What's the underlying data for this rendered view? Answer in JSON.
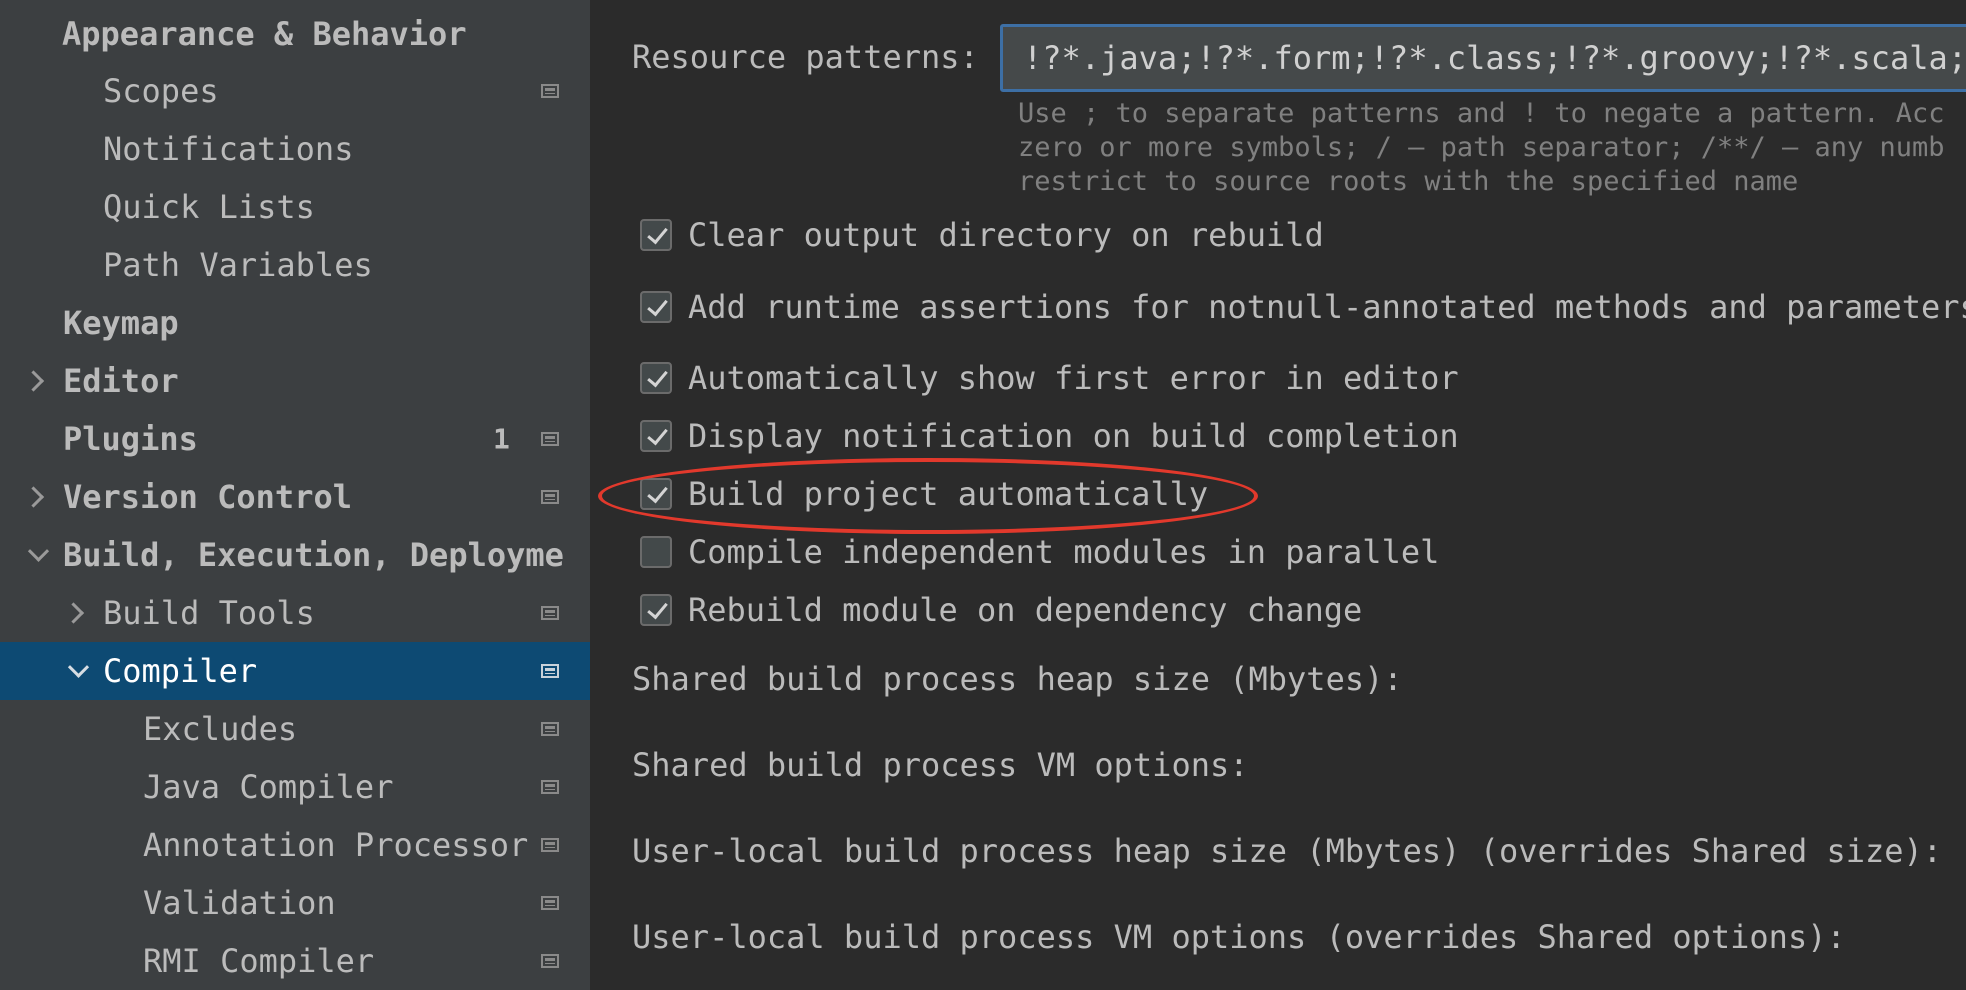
{
  "sidebar": {
    "items": [
      {
        "label": "Appearance & Behavior"
      },
      {
        "label": "Scopes"
      },
      {
        "label": "Notifications"
      },
      {
        "label": "Quick Lists"
      },
      {
        "label": "Path Variables"
      },
      {
        "label": "Keymap"
      },
      {
        "label": "Editor"
      },
      {
        "label": "Plugins",
        "badge": "1"
      },
      {
        "label": "Version Control"
      },
      {
        "label": "Build, Execution, Deployment"
      },
      {
        "label": "Build Tools"
      },
      {
        "label": "Compiler"
      },
      {
        "label": "Excludes"
      },
      {
        "label": "Java Compiler"
      },
      {
        "label": "Annotation Processors"
      },
      {
        "label": "Validation"
      },
      {
        "label": "RMI Compiler"
      }
    ]
  },
  "compiler": {
    "resource_patterns_label": "Resource patterns:",
    "resource_patterns_value": "!?*.java;!?*.form;!?*.class;!?*.groovy;!?*.scala;",
    "hint_lines": [
      "Use ; to separate patterns and ! to negate a pattern. Acc",
      "zero or more symbols; / — path separator; /**/ — any numb",
      "restrict to source roots with the specified name"
    ],
    "checkboxes": [
      {
        "label": "Clear output directory on rebuild",
        "checked": true
      },
      {
        "label": "Add runtime assertions for notnull-annotated methods and parameters",
        "checked": true
      },
      {
        "label": "Automatically show first error in editor",
        "checked": true
      },
      {
        "label": "Display notification on build completion",
        "checked": true
      },
      {
        "label": "Build project automatically",
        "checked": true
      },
      {
        "label": "Compile independent modules in parallel",
        "checked": false
      },
      {
        "label": "Rebuild module on dependency change",
        "checked": true
      }
    ],
    "shared_heap_label": "Shared build process heap size (Mbytes):",
    "shared_vm_label": "Shared build process VM options:",
    "user_heap_label": "User-local build process heap size (Mbytes) (overrides Shared size):",
    "user_vm_label": "User-local build process VM options (overrides Shared options):"
  },
  "colors": {
    "selection": "#0d4a73",
    "highlight_annotation": "#e2392c",
    "field_focus_border": "#3d6fa5"
  }
}
